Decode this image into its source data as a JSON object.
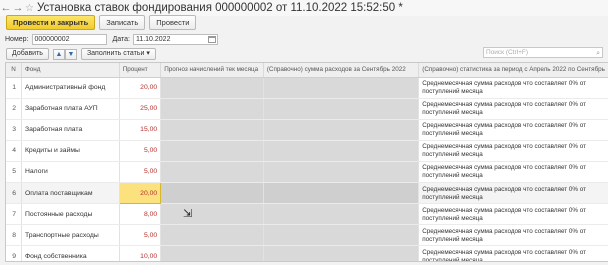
{
  "window": {
    "back_glyph": "←",
    "forward_glyph": "→",
    "star_glyph": "☆",
    "title": "Установка ставок фондирования 000000002 от 11.10.2022 15:52:50 *"
  },
  "toolbar": {
    "post_close_label": "Провести и закрыть",
    "save_label": "Записать",
    "post_label": "Провести"
  },
  "header": {
    "number_label": "Номер:",
    "number_value": "000000002",
    "date_label": "Дата:",
    "date_value": "11.10.2022"
  },
  "table_toolbar": {
    "add_label": "Добавить",
    "up_glyph": "▲",
    "down_glyph": "▼",
    "fill_label": "Заполнить статьи ▾",
    "search_placeholder": "Поиск (Ctrl+F)",
    "search_glyph": "⌕"
  },
  "table": {
    "columns": [
      "N",
      "Фонд",
      "Процент",
      "Прогноз начислений тек месяца",
      "(Справочно) сумма расходов за Сентябрь 2022",
      "(Справочно) статистика за период с Апрель 2022 по Сентябрь"
    ],
    "rows": [
      {
        "n": "1",
        "fund": "Административный фонд",
        "pct": "20,00",
        "stat_line1": "Среднемесячная сумма расходов  что составляет 0% от",
        "stat_line2": "поступлений месяца"
      },
      {
        "n": "2",
        "fund": "Заработная плата АУП",
        "pct": "25,00",
        "stat_line1": "Среднемесячная сумма расходов  что составляет 0% от",
        "stat_line2": "поступлений месяца"
      },
      {
        "n": "3",
        "fund": "Заработная плата",
        "pct": "15,00",
        "stat_line1": "Среднемесячная сумма расходов  что составляет 0% от",
        "stat_line2": "поступлений месяца"
      },
      {
        "n": "4",
        "fund": "Кредиты и займы",
        "pct": "5,00",
        "stat_line1": "Среднемесячная сумма расходов  что составляет 0% от",
        "stat_line2": "поступлений месяца"
      },
      {
        "n": "5",
        "fund": "Налоги",
        "pct": "5,00",
        "stat_line1": "Среднемесячная сумма расходов  что составляет 0% от",
        "stat_line2": "поступлений месяца"
      },
      {
        "n": "6",
        "fund": "Оплата поставщикам",
        "pct": "20,00",
        "stat_line1": "Среднемесячная сумма расходов  что составляет 0% от",
        "stat_line2": "поступлений месяца"
      },
      {
        "n": "7",
        "fund": "Постоянные расходы",
        "pct": "8,00",
        "stat_line1": "Среднемесячная сумма расходов  что составляет 0% от",
        "stat_line2": "поступлений месяца"
      },
      {
        "n": "8",
        "fund": "Транспортные расходы",
        "pct": "5,00",
        "stat_line1": "Среднемесячная сумма расходов  что составляет 0% от",
        "stat_line2": "поступлений месяца"
      },
      {
        "n": "9",
        "fund": "Фонд собственника",
        "pct": "10,00",
        "stat_line1": "Среднемесячная сумма расходов  что составляет 0% от",
        "stat_line2": "поступлений месяца"
      }
    ],
    "selected_row": 5
  },
  "cursor_glyph": "⇲"
}
